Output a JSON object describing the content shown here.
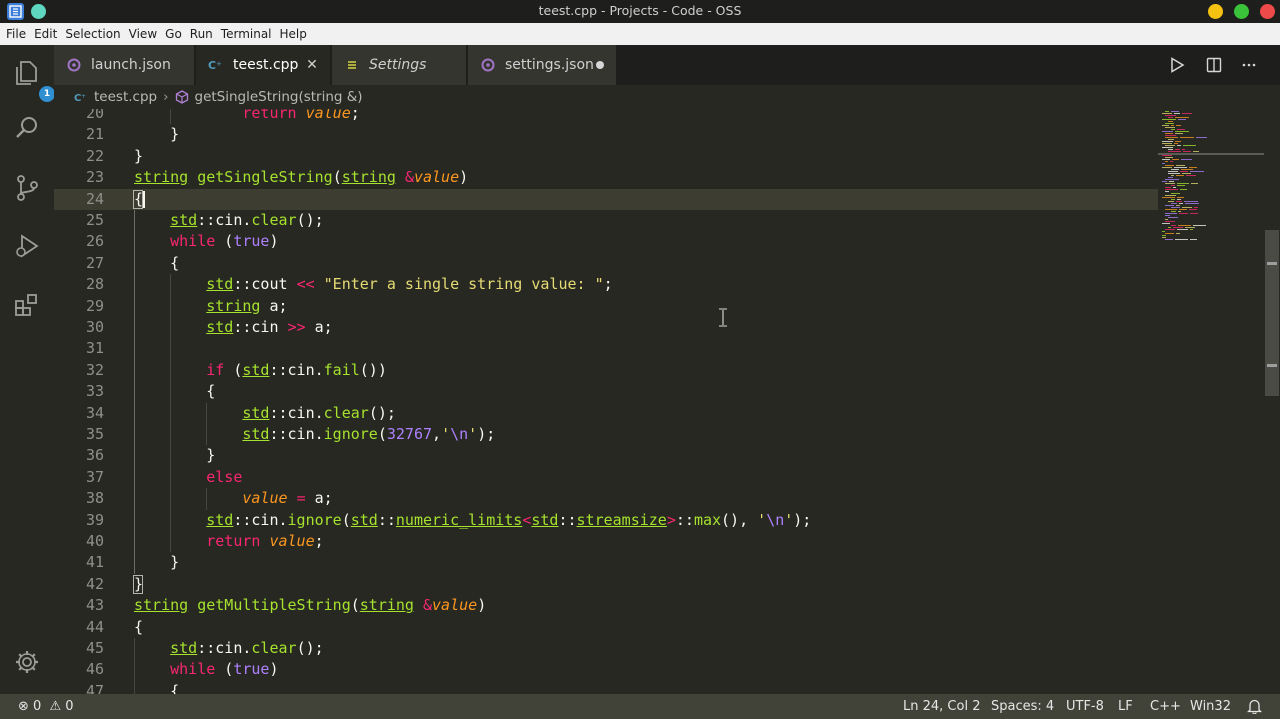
{
  "window": {
    "title": "teest.cpp - Projects - Code - OSS"
  },
  "menu": [
    "File",
    "Edit",
    "Selection",
    "View",
    "Go",
    "Run",
    "Terminal",
    "Help"
  ],
  "activity_bar": {
    "explorer_badge": "1"
  },
  "tabs": [
    {
      "label": "launch.json",
      "icon": "json-gear-icon",
      "italic": false,
      "active": false,
      "state": ""
    },
    {
      "label": "teest.cpp",
      "icon": "cpp-file-icon",
      "italic": false,
      "active": true,
      "state": "close"
    },
    {
      "label": "Settings",
      "icon": "settings-list-icon",
      "italic": true,
      "active": false,
      "state": ""
    },
    {
      "label": "settings.json",
      "icon": "json-gear-icon",
      "italic": false,
      "active": false,
      "state": "dirty"
    }
  ],
  "breadcrumb": {
    "file": "teest.cpp",
    "symbol": "getSingleString(string &)"
  },
  "editor": {
    "current_line": 24,
    "lines": [
      {
        "n": "20",
        "t": "            return value;"
      },
      {
        "n": "21",
        "t": "    }"
      },
      {
        "n": "22",
        "t": "}"
      },
      {
        "n": "23",
        "t": "string getSingleString(string &value)"
      },
      {
        "n": "24",
        "t": "{"
      },
      {
        "n": "25",
        "t": "    std::cin.clear();"
      },
      {
        "n": "26",
        "t": "    while (true)"
      },
      {
        "n": "27",
        "t": "    {"
      },
      {
        "n": "28",
        "t": "        std::cout << \"Enter a single string value: \";"
      },
      {
        "n": "29",
        "t": "        string a;"
      },
      {
        "n": "30",
        "t": "        std::cin >> a;"
      },
      {
        "n": "31",
        "t": ""
      },
      {
        "n": "32",
        "t": "        if (std::cin.fail())"
      },
      {
        "n": "33",
        "t": "        {"
      },
      {
        "n": "34",
        "t": "            std::cin.clear();"
      },
      {
        "n": "35",
        "t": "            std::cin.ignore(32767,'\\n');"
      },
      {
        "n": "36",
        "t": "        }"
      },
      {
        "n": "37",
        "t": "        else"
      },
      {
        "n": "38",
        "t": "            value = a;"
      },
      {
        "n": "39",
        "t": "        std::cin.ignore(std::numeric_limits<std::streamsize>::max(), '\\n');"
      },
      {
        "n": "40",
        "t": "        return value;"
      },
      {
        "n": "41",
        "t": "    }"
      },
      {
        "n": "42",
        "t": "}"
      },
      {
        "n": "43",
        "t": "string getMultipleString(string &value)"
      },
      {
        "n": "44",
        "t": "{"
      },
      {
        "n": "45",
        "t": "    std::cin.clear();"
      },
      {
        "n": "46",
        "t": "    while (true)"
      },
      {
        "n": "47",
        "t": "    {"
      }
    ]
  },
  "status": {
    "errors": "0",
    "warnings": "0",
    "position": "Ln 24, Col 2",
    "spaces": "Spaces: 4",
    "encoding": "UTF-8",
    "eol": "LF",
    "language": "C++",
    "platform": "Win32"
  },
  "colors": {
    "editor_bg": "#272822",
    "keyword": "#f92672",
    "type": "#a6e22e",
    "parameter": "#fd971f",
    "string": "#e6db74",
    "number": "#ae81ff",
    "statusbar_bg": "#414339"
  }
}
